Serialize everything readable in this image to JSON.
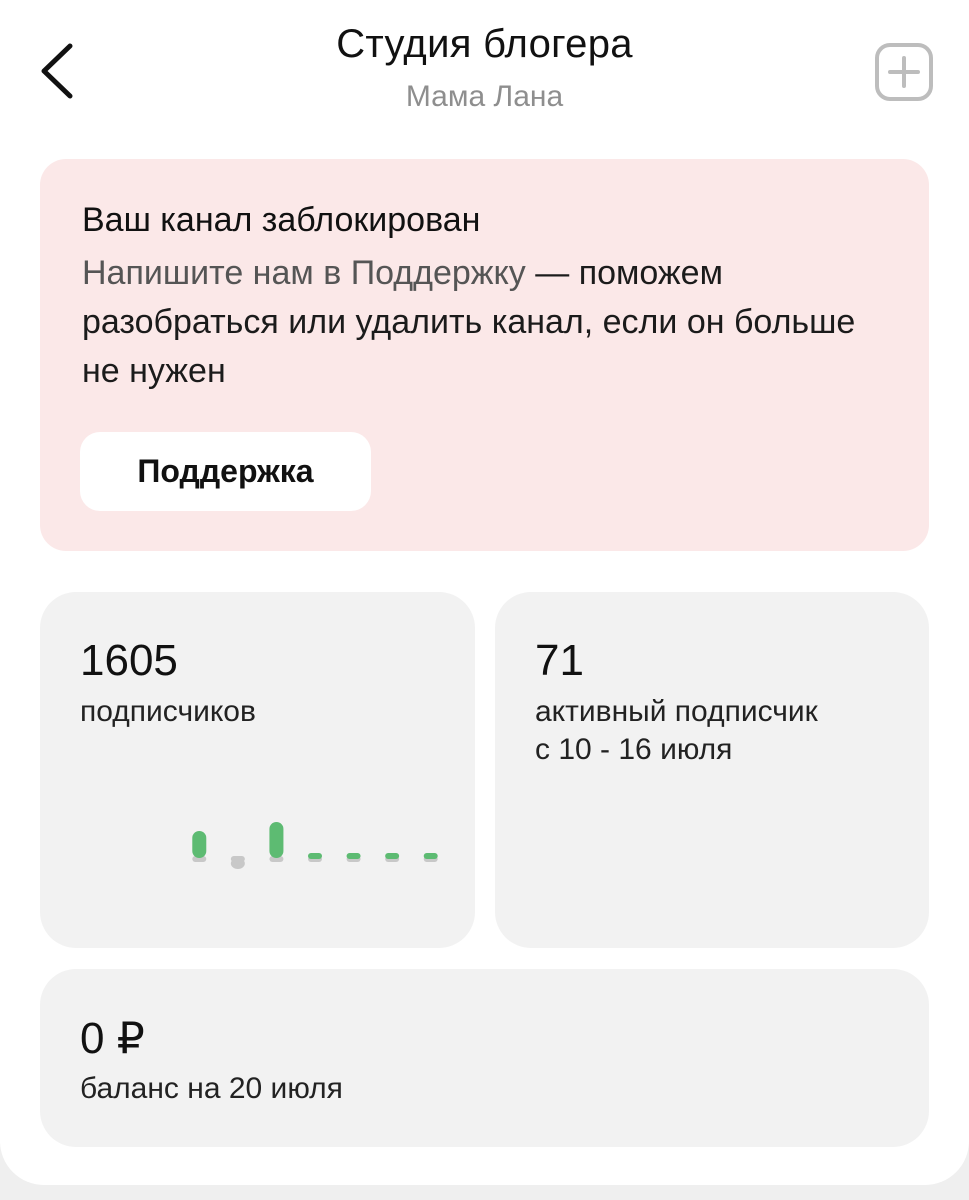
{
  "header": {
    "title": "Студия блогера",
    "subtitle": "Мама Лана"
  },
  "alert": {
    "title": "Ваш канал заблокирован",
    "text_link": "Напишите нам в Поддержку",
    "text_rest": " — поможем разобраться или удалить канал, если он больше не нужен",
    "button_label": "Поддержка",
    "background_color": "#fbe8e8"
  },
  "stats": {
    "subscribers": {
      "value": "1605",
      "label": "подписчиков"
    },
    "active": {
      "value": "71",
      "label_line1": "активный подписчик",
      "label_line2": "с 10 - 16 июля"
    },
    "balance": {
      "value": "0 ₽",
      "label": "баланс на 20 июля"
    }
  },
  "chart_data": {
    "type": "bar",
    "title": "",
    "xlabel": "",
    "ylabel": "",
    "categories": [
      "1",
      "2",
      "3",
      "4",
      "5",
      "6",
      "7"
    ],
    "values": [
      3,
      -1,
      4,
      0,
      0,
      0,
      0
    ],
    "ylim": [
      -1,
      4
    ],
    "colors": {
      "positive": "#5dbb72",
      "negative": "#c8c8c8",
      "baseline": "#c8c8c8"
    },
    "grid": false,
    "axis_labels_shown": false
  },
  "icons": {
    "back": "chevron-left-icon",
    "add": "plus-square-icon"
  }
}
